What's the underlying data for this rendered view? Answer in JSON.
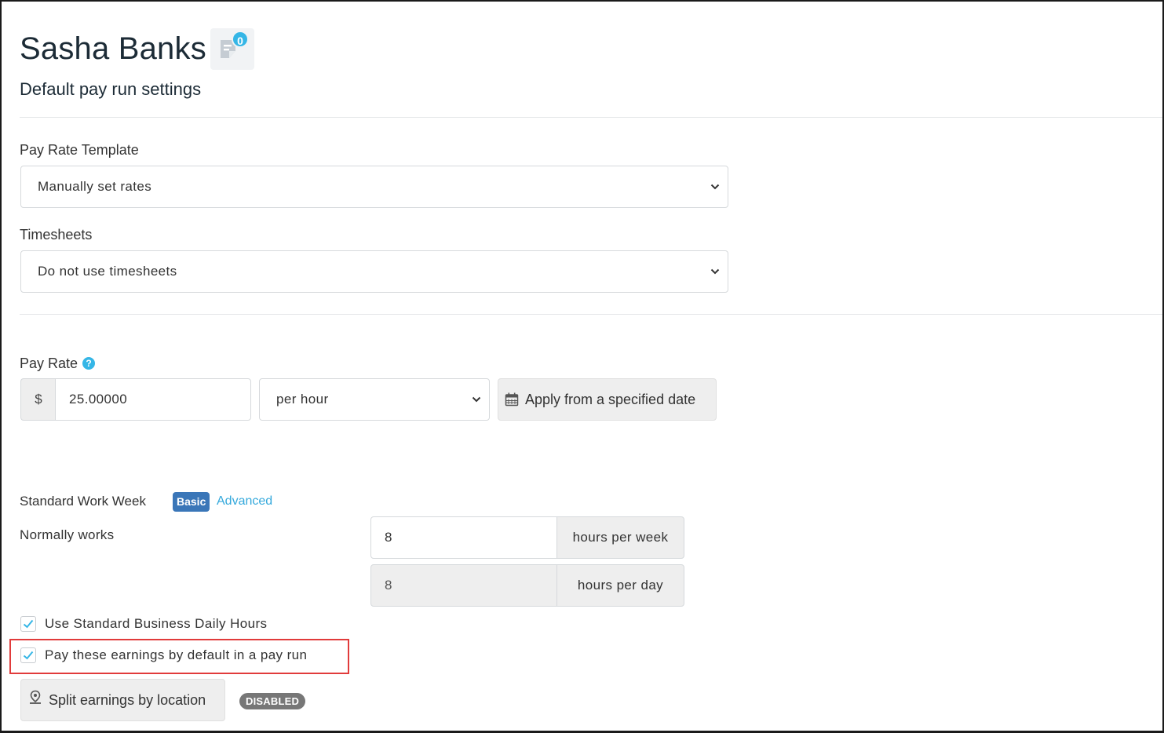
{
  "header": {
    "employee_name": "Sasha Banks",
    "notes_count": "0",
    "subtitle": "Default pay run settings"
  },
  "pay_rate_template": {
    "label": "Pay Rate Template",
    "selected": "Manually set rates"
  },
  "timesheets": {
    "label": "Timesheets",
    "selected": "Do not use timesheets"
  },
  "pay_rate": {
    "label": "Pay Rate",
    "help_glyph": "?",
    "currency_symbol": "$",
    "amount": "25.00000",
    "unit_selected": "per hour",
    "apply_date_button": "Apply from a specified date"
  },
  "work_week": {
    "label": "Standard Work Week",
    "basic_tab": "Basic",
    "advanced_tab": "Advanced",
    "normally_works_label": "Normally works",
    "hours_per_week_value": "8",
    "hours_per_week_suffix": "hours per week",
    "hours_per_day_value": "8",
    "hours_per_day_suffix": "hours per day"
  },
  "checkboxes": {
    "use_standard_hours": {
      "label": "Use Standard Business Daily Hours",
      "checked": true
    },
    "pay_by_default": {
      "label": "Pay these earnings by default in a pay run",
      "checked": true
    }
  },
  "split_earnings": {
    "button_label": "Split earnings by location",
    "status_badge": "DISABLED"
  },
  "icons": {
    "notes": "notes-icon",
    "chevron": "chevron-down-icon",
    "calendar": "calendar-icon",
    "location": "map-pin-icon",
    "check": "check-icon"
  },
  "colors": {
    "accent_blue": "#35b6e6",
    "basic_pill": "#3a76b8",
    "highlight_red": "#e13b3b",
    "badge_gray": "#777777"
  }
}
